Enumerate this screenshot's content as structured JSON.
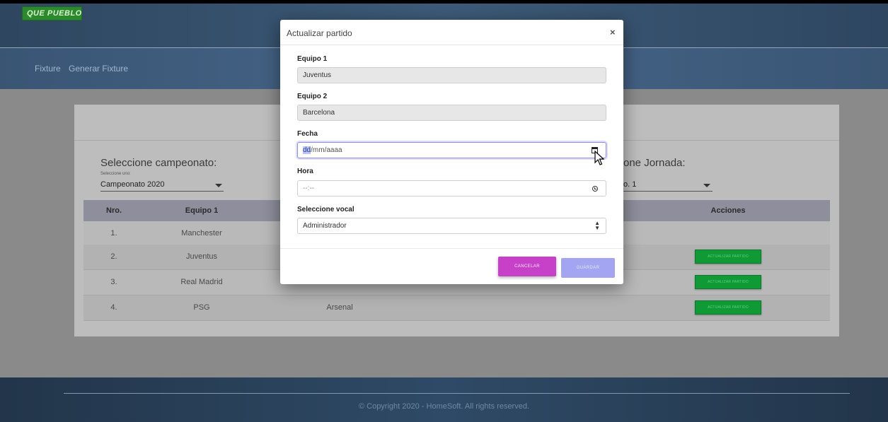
{
  "brand": {
    "logo_text": "QUE PUEBLO !"
  },
  "nav": {
    "items": [
      {
        "label": "Fixture"
      },
      {
        "label": "Generar Fixture"
      }
    ]
  },
  "filters": {
    "championship": {
      "label": "Seleccione campeonato:",
      "helper": "Seleccione uno:",
      "value": "Campeonato 2020"
    },
    "round": {
      "label": "one Jornada:",
      "value": "o. 1"
    }
  },
  "table": {
    "headers": [
      "Nro.",
      "Equipo 1",
      "Acciones"
    ],
    "rows": [
      {
        "nro": "1.",
        "team1": "Manchester",
        "team2": "",
        "has_action": false
      },
      {
        "nro": "2.",
        "team1": "Juventus",
        "team2": "",
        "has_action": true
      },
      {
        "nro": "3.",
        "team1": "Real Madrid",
        "team2": "",
        "has_action": true
      },
      {
        "nro": "4.",
        "team1": "PSG",
        "team2": "Arsenal",
        "has_action": true
      }
    ],
    "action_label": "Actualizar partido"
  },
  "footer": {
    "text": "© Copyright 2020 - HomeSoft. All rights reserved."
  },
  "modal": {
    "title": "Actualizar partido",
    "close": "×",
    "team1": {
      "label": "Equipo 1",
      "value": "Juventus"
    },
    "team2": {
      "label": "Equipo 2",
      "value": "Barcelona"
    },
    "date": {
      "label": "Fecha",
      "dd": "dd",
      "rest": "/mm/aaaa"
    },
    "time": {
      "label": "Hora",
      "placeholder": "--:--"
    },
    "vocal": {
      "label": "Seleccione vocal",
      "value": "Administrador"
    },
    "cancel_label": "Cancelar",
    "save_label": "Guardar"
  },
  "colors": {
    "cancel": "#c640c8",
    "save": "#a3a4f2",
    "action": "#0f9a35",
    "focus": "#8f8fe6"
  }
}
